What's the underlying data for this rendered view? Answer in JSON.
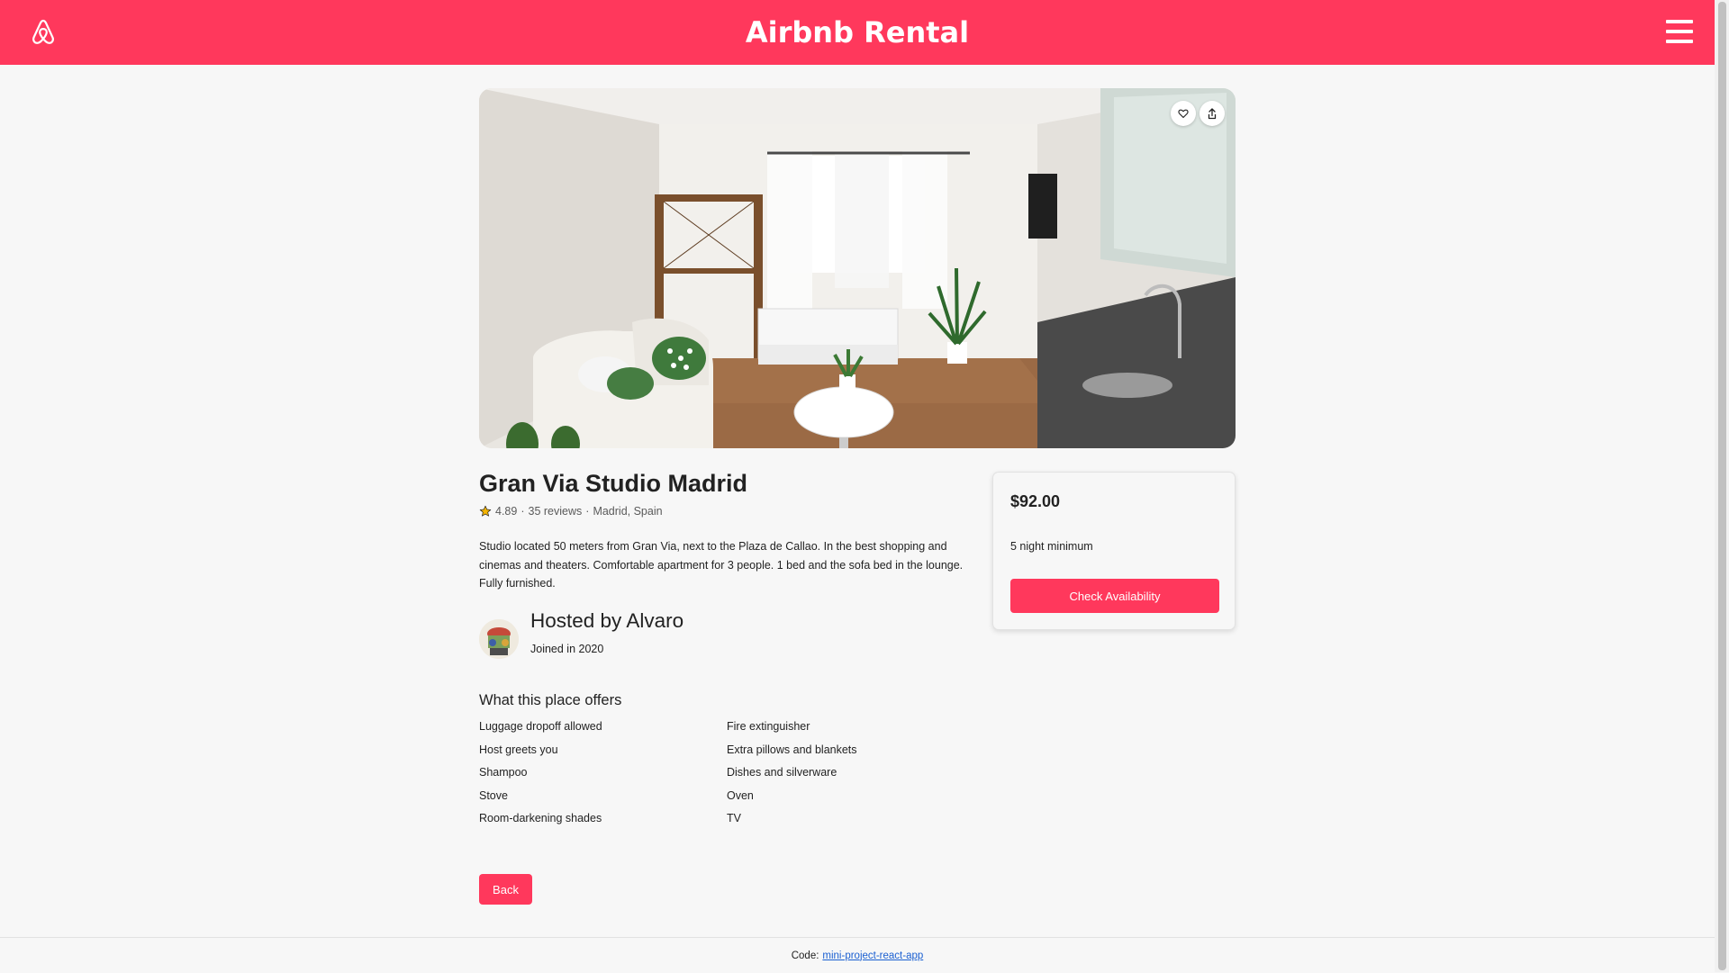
{
  "header": {
    "title": "Airbnb Rental"
  },
  "listing": {
    "title": "Gran Via Studio Madrid",
    "rating": "4.89",
    "reviews": "35 reviews",
    "location": "Madrid, Spain",
    "separator": "·",
    "description": "Studio located 50 meters from Gran Via, next to the Plaza de Callao. In the best shopping and cinemas and theaters. Comfortable apartment for 3 people. 1 bed and the sofa bed in the lounge. Fully furnished."
  },
  "host": {
    "name": "Hosted by Alvaro",
    "joined": "Joined in 2020"
  },
  "offers": {
    "title": "What this place offers",
    "items": [
      "Luggage dropoff allowed",
      "Fire extinguisher",
      "Host greets you",
      "Extra pillows and blankets",
      "Shampoo",
      "Dishes and silverware",
      "Stove",
      "Oven",
      "Room-darkening shades",
      "TV"
    ]
  },
  "booking": {
    "price": "$92.00",
    "minimum": "5 night minimum",
    "button": "Check Availability"
  },
  "actions": {
    "back": "Back"
  },
  "footer": {
    "prefix": "Code:",
    "link": "mini-project-react-app"
  },
  "icons": {
    "logo": "airbnb-logo-icon",
    "menu": "hamburger-menu-icon",
    "heart": "heart-icon",
    "share": "share-icon",
    "star": "star-icon"
  },
  "colors": {
    "brand": "#ff385c",
    "background": "#f7f7f7",
    "link": "#1a5fd1",
    "star": "#f5b400"
  }
}
